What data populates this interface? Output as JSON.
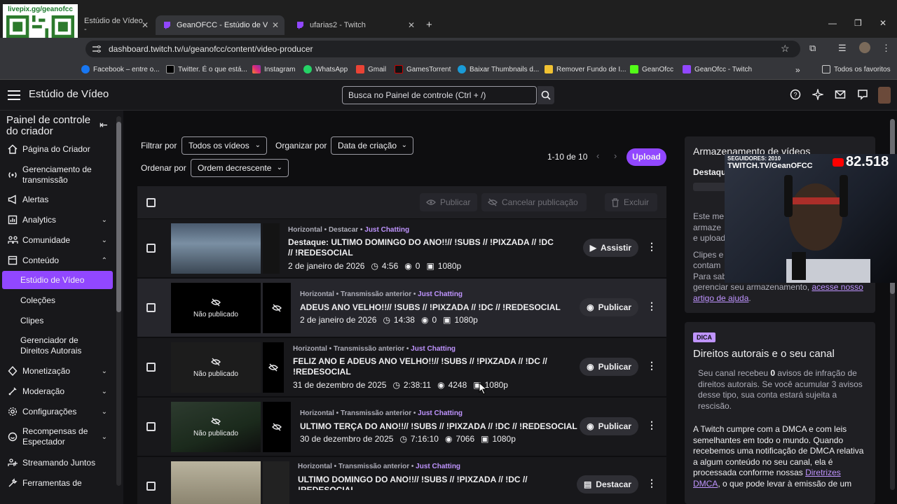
{
  "browser": {
    "tabs": [
      {
        "label": "Estúdio de Vídeo -"
      },
      {
        "label": "GeanOFCC - Estúdio de Vídeo -"
      },
      {
        "label": "ufarias2 - Twitch"
      }
    ],
    "url": "dashboard.twitch.tv/u/geanofcc/content/video-producer",
    "bookmarks": [
      "Facebook – entre o...",
      "Twitter. É o que está...",
      "Instagram",
      "WhatsApp",
      "Gmail",
      "GamesTorrent",
      "Baixar Thumbnails d...",
      "Remover Fundo de I...",
      "GeanOfcc",
      "GeanOfcc - Twitch"
    ],
    "all_favorites": "Todos os favoritos"
  },
  "overlay": {
    "qr_label": "livepix.gg/geanofcc",
    "webcam_followers": "SEGUIDORES: 2010",
    "webcam_channel": "TWITCH.TV/GeanOFCC",
    "webcam_counter": "82.518"
  },
  "topnav": {
    "title": "Estúdio de Vídeo",
    "search_placeholder": "Busca no Painel de controle (Ctrl + /)"
  },
  "sidebar": {
    "heading": "Painel de controle do criador",
    "items": [
      {
        "label": "Página do Criador"
      },
      {
        "label": "Gerenciamento de transmissão"
      },
      {
        "label": "Alertas"
      },
      {
        "label": "Analytics"
      },
      {
        "label": "Comunidade"
      },
      {
        "label": "Conteúdo"
      },
      {
        "label": "Monetização"
      },
      {
        "label": "Moderação"
      },
      {
        "label": "Configurações"
      },
      {
        "label": "Recompensas de Espectador"
      },
      {
        "label": "Streamando Juntos"
      },
      {
        "label": "Ferramentas de"
      }
    ],
    "subitems": [
      {
        "label": "Estúdio de Vídeo"
      },
      {
        "label": "Coleções"
      },
      {
        "label": "Clipes"
      },
      {
        "label": "Gerenciador de Direitos Autorais"
      }
    ]
  },
  "filters": {
    "filter_label": "Filtrar por",
    "filter_value": "Todos os vídeos",
    "organize_label": "Organizar por",
    "organize_value": "Data de criação",
    "order_label": "Ordenar por",
    "order_value": "Ordem decrescente",
    "pager": "1-10 de 10",
    "upload": "Upload"
  },
  "table": {
    "publish": "Publicar",
    "unpublish": "Cancelar publicação",
    "delete": "Excluir",
    "not_published": "Não publicado",
    "videos": [
      {
        "meta": "Horizontal • Destacar • ",
        "category": "Just Chatting",
        "title": "Destaque: ULTIMO DOMINGO DO ANO!!// !SUBS // !PIXZADA // !DC // !REDESOCIAL",
        "date": "2 de janeiro de 2026",
        "duration": "4:56",
        "views": "0",
        "quality": "1080p",
        "action": "Assistir"
      },
      {
        "meta": "Horizontal • Transmissão anterior • ",
        "category": "Just Chatting",
        "title": "ADEUS ANO VELHO!!// !SUBS // !PIXZADA // !DC // !REDESOCIAL",
        "date": "2 de janeiro de 2026",
        "duration": "14:38",
        "views": "0",
        "quality": "1080p",
        "action": "Publicar"
      },
      {
        "meta": "Horizontal • Transmissão anterior • ",
        "category": "Just Chatting",
        "title": "FELIZ ANO E ADEUS ANO VELHO!!// !SUBS // !PIXZADA // !DC // !REDESOCIAL",
        "date": "31 de dezembro de 2025",
        "duration": "2:38:11",
        "views": "4248",
        "quality": "1080p",
        "action": "Publicar"
      },
      {
        "meta": "Horizontal • Transmissão anterior • ",
        "category": "Just Chatting",
        "title": "ULTIMO TERÇA DO ANO!!// !SUBS // !PIXZADA // !DC // !REDESOCIAL",
        "date": "30 de dezembro de 2025",
        "duration": "7:16:10",
        "views": "7066",
        "quality": "1080p",
        "action": "Publicar"
      },
      {
        "meta": "Horizontal • Transmissão anterior • ",
        "category": "Just Chatting",
        "title": "ULTIMO DOMINGO DO ANO!!// !SUBS // !PIXZADA // !DC // !REDESOCIAL",
        "action": "Destacar"
      }
    ]
  },
  "storage": {
    "title": "Armazenamento de vídeos",
    "destaque": "Destaque",
    "text1a": "Este me",
    "text1b": "armaze",
    "text1c": "e upload",
    "text2a": "Clipes e",
    "text2b": "contam",
    "text2c": "Para sab",
    "text3": "gerenciar seu armazenamento,",
    "link": "acesse nosso artigo de ajuda",
    "link_end": "."
  },
  "copyright": {
    "badge": "DICA",
    "title": "Direitos autorais e o seu canal",
    "p1_before": "Seu canal recebeu ",
    "p1_count": "0",
    "p1_after": " avisos de infração de direitos autorais. Se você acumular 3 avisos desse tipo, sua conta estará sujeita a rescisão.",
    "p2": "A Twitch cumpre com a DMCA e com leis semelhantes em todo o mundo. Quando recebemos uma notificação de DMCA relativa a algum conteúdo no seu canal, ela é processada conforme nossas",
    "p2_link": "Diretrizes DMCA",
    "p2_end": ", o que pode levar à emissão de um"
  },
  "colors": {
    "accent": "#9147ff",
    "link": "#bf94ff",
    "bg": "#0e0e10",
    "panel": "#18181b"
  }
}
